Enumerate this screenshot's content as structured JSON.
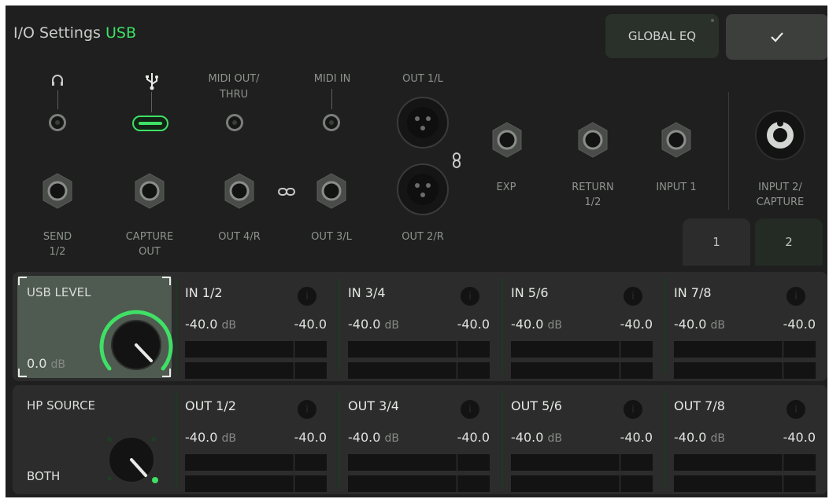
{
  "header": {
    "title": "I/O Settings",
    "mode": "USB",
    "global_eq_label": "GLOBAL EQ",
    "confirm_icon": "check-icon"
  },
  "io": {
    "top_labels": {
      "midi_out": "MIDI OUT/",
      "midi_out_2": "THRU",
      "midi_in": "MIDI IN",
      "out1": "OUT 1/L"
    },
    "bottom_labels": {
      "send": "SEND",
      "send_2": "1/2",
      "capture_out": "CAPTURE",
      "capture_out_2": "OUT",
      "out4": "OUT 4/R",
      "out3": "OUT 3/L",
      "out2": "OUT 2/R"
    },
    "right_labels": {
      "exp": "EXP",
      "return": "RETURN",
      "return_2": "1/2",
      "input1": "INPUT 1",
      "input2": "INPUT 2/",
      "input2_2": "CAPTURE"
    }
  },
  "tabs": [
    {
      "label": "1"
    },
    {
      "label": "2"
    }
  ],
  "active_tab": "1",
  "accent": "#3fe065",
  "usb_level": {
    "label": "USB LEVEL",
    "value": "0.0",
    "unit": "dB",
    "knob_fraction": 0.75
  },
  "hp_source": {
    "label": "HP SOURCE",
    "value": "BOTH"
  },
  "inputs": [
    {
      "name": "IN 1/2",
      "left": "-40.0",
      "unit": "dB",
      "right": "-40.0"
    },
    {
      "name": "IN 3/4",
      "left": "-40.0",
      "unit": "dB",
      "right": "-40.0"
    },
    {
      "name": "IN 5/6",
      "left": "-40.0",
      "unit": "dB",
      "right": "-40.0"
    },
    {
      "name": "IN 7/8",
      "left": "-40.0",
      "unit": "dB",
      "right": "-40.0"
    }
  ],
  "outputs": [
    {
      "name": "OUT 1/2",
      "left": "-40.0",
      "unit": "dB",
      "right": "-40.0"
    },
    {
      "name": "OUT 3/4",
      "left": "-40.0",
      "unit": "dB",
      "right": "-40.0"
    },
    {
      "name": "OUT 5/6",
      "left": "-40.0",
      "unit": "dB",
      "right": "-40.0"
    },
    {
      "name": "OUT 7/8",
      "left": "-40.0",
      "unit": "dB",
      "right": "-40.0"
    }
  ]
}
